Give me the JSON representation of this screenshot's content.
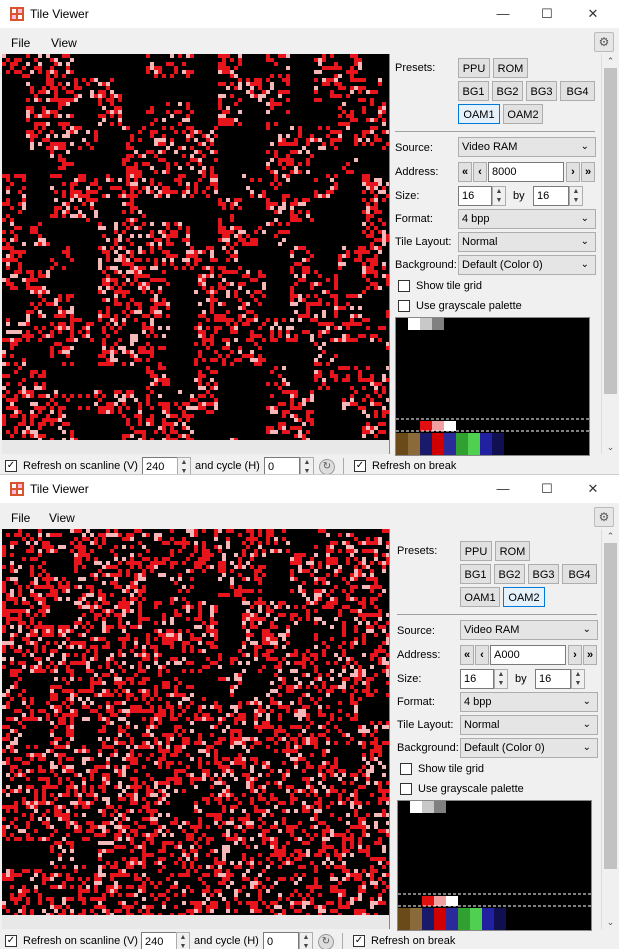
{
  "windows": [
    {
      "title": "Tile Viewer",
      "menu": [
        "File",
        "View"
      ],
      "presets_label": "Presets:",
      "presets": [
        [
          "PPU",
          "ROM"
        ],
        [
          "BG1",
          "BG2",
          "BG3",
          "BG4"
        ],
        [
          "OAM1",
          "OAM2"
        ]
      ],
      "selected_preset": "OAM1",
      "source_label": "Source:",
      "source": "Video RAM",
      "address_label": "Address:",
      "address": "8000",
      "size_label": "Size:",
      "size_w": "16",
      "by_label": "by",
      "size_h": "16",
      "format_label": "Format:",
      "format": "4 bpp",
      "layout_label": "Tile Layout:",
      "layout": "Normal",
      "background_label": "Background:",
      "background": "Default (Color 0)",
      "show_grid_label": "Show tile grid",
      "show_grid": false,
      "grayscale_label": "Use grayscale palette",
      "grayscale": false,
      "refresh_scanline_label": "Refresh on scanline (V)",
      "scanline": "240",
      "cycle_label": "and cycle (H)",
      "cycle": "0",
      "refresh_break_label": "Refresh on break",
      "refresh_scanline": true,
      "refresh_break": true
    },
    {
      "title": "Tile Viewer",
      "menu": [
        "File",
        "View"
      ],
      "presets_label": "Presets:",
      "presets": [
        [
          "PPU",
          "ROM"
        ],
        [
          "BG1",
          "BG2",
          "BG3",
          "BG4"
        ],
        [
          "OAM1",
          "OAM2"
        ]
      ],
      "selected_preset": "OAM2",
      "source_label": "Source:",
      "source": "Video RAM",
      "address_label": "Address:",
      "address": "A000",
      "size_label": "Size:",
      "size_w": "16",
      "by_label": "by",
      "size_h": "16",
      "format_label": "Format:",
      "format": "4 bpp",
      "layout_label": "Tile Layout:",
      "layout": "Normal",
      "background_label": "Background:",
      "background": "Default (Color 0)",
      "show_grid_label": "Show tile grid",
      "show_grid": false,
      "grayscale_label": "Use grayscale palette",
      "grayscale": false,
      "refresh_scanline_label": "Refresh on scanline (V)",
      "scanline": "240",
      "cycle_label": "and cycle (H)",
      "cycle": "0",
      "refresh_break_label": "Refresh on break",
      "refresh_scanline": true,
      "refresh_break": true
    }
  ],
  "colors": {
    "tile_red": "#e8141c",
    "tile_pink": "#f5b8b8",
    "tile_bg": "#000000",
    "selected_border": "#0078d7"
  },
  "palette_strip": {
    "top_row": [
      "#000000",
      "#ffffff",
      "#c8c8c8",
      "#808080"
    ],
    "bottom_row": [
      "#6b4a1a",
      "#8a6a3a",
      "#1a1a6a",
      "#d00000",
      "#2a2a9a",
      "#30a030",
      "#50d050",
      "#2020a0",
      "#101050",
      "#000000"
    ],
    "red_row": [
      "#e01010",
      "#f0a0a0",
      "#ffffff"
    ]
  }
}
